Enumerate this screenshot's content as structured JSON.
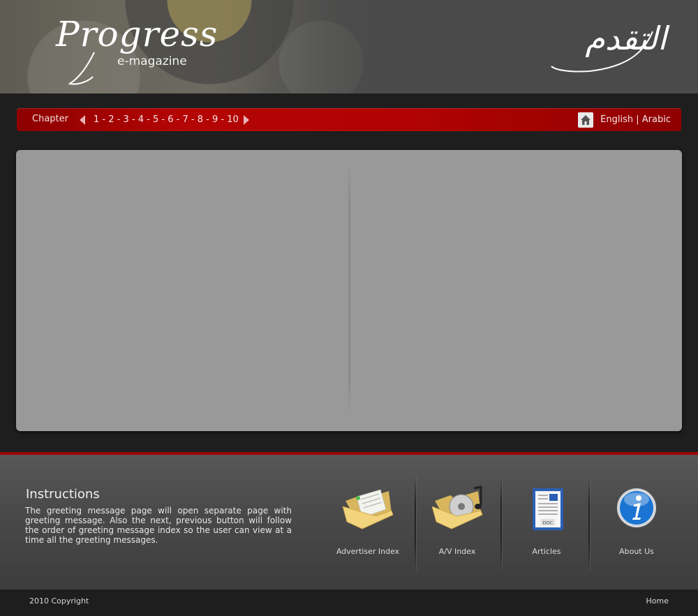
{
  "header": {
    "logo_title": "Progress",
    "logo_subtitle": "e-magazine",
    "logo_arabic": "التقدم"
  },
  "nav": {
    "chapter_label": "Chapter",
    "pages": [
      "1",
      "2",
      "3",
      "4",
      "5",
      "6",
      "7",
      "8",
      "9",
      "10"
    ],
    "separator": " - ",
    "lang_english": "English",
    "lang_divider": " | ",
    "lang_arabic": "Arabic"
  },
  "instructions": {
    "title": "Instructions",
    "text": "The greeting message page will open separate page with greeting message. Also the next, previous button will follow the order of greeting message index so the user can view at a time all the greeting messages."
  },
  "tiles": [
    {
      "label": "Advertiser Index",
      "icon": "folder-documents-icon"
    },
    {
      "label": "A/V Index",
      "icon": "folder-media-icon"
    },
    {
      "label": "Articles",
      "icon": "doc-file-icon"
    },
    {
      "label": "About Us",
      "icon": "info-icon"
    }
  ],
  "footer": {
    "copyright": "2010 Copyright",
    "home_link": "Home"
  },
  "colors": {
    "accent_red": "#b40404",
    "viewer_bg": "#999999",
    "page_bg": "#1e1e1e"
  }
}
